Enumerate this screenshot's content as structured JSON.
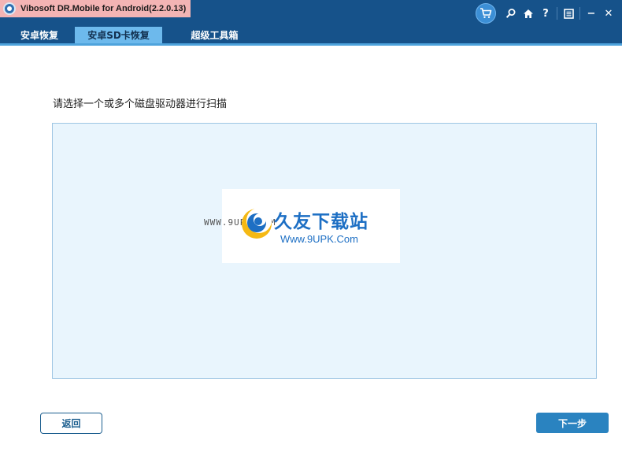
{
  "window": {
    "title": "Vibosoft DR.Mobile for Android(2.2.0.13)",
    "icons": [
      "cart-icon",
      "search-icon",
      "home-icon",
      "help-icon",
      "register-icon",
      "minimize-icon",
      "close-icon"
    ],
    "icon_glyphs": {
      "help": "?",
      "minimize": "−",
      "close": "✕"
    }
  },
  "tabs": [
    {
      "label": "安卓恢复",
      "active": false
    },
    {
      "label": "安卓SD卡恢复",
      "active": true
    },
    {
      "label": "超级工具箱",
      "active": false
    }
  ],
  "main": {
    "prompt": "请选择一个或多个磁盘驱动器进行扫描"
  },
  "watermark": {
    "small_text": "WWW.9UPK.COM",
    "brand": "久友下载站",
    "url": "Www.9UPK.Com"
  },
  "buttons": {
    "back": "返回",
    "next": "下一步"
  },
  "colors": {
    "titlebar": "#16528a",
    "title_highlight": "#f3b4b4",
    "tab_active": "#6db9ec",
    "tab_underline": "#4ea3dc",
    "drive_area_bg": "#e9f5fd",
    "primary_button": "#2a83c0"
  }
}
